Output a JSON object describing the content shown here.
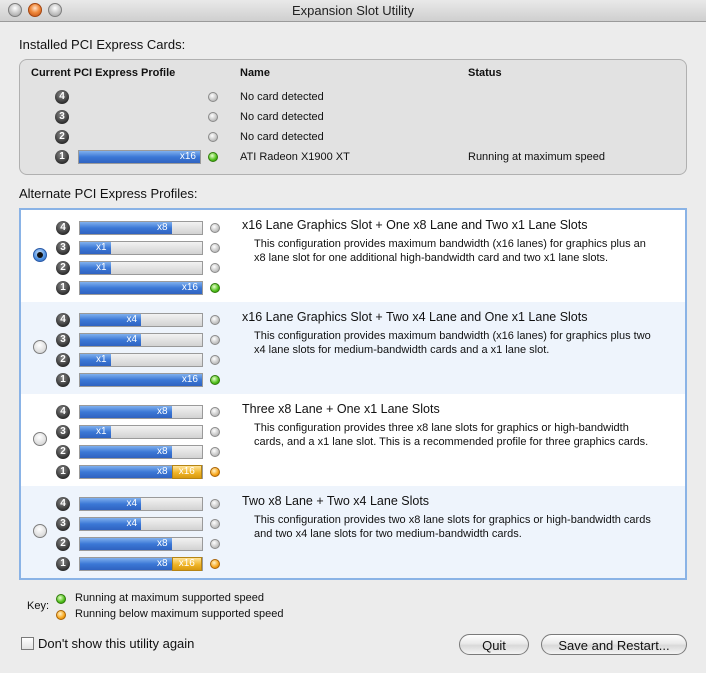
{
  "window": {
    "title": "Expansion Slot Utility"
  },
  "installed": {
    "section_label": "Installed PCI Express Cards:",
    "headers": {
      "profile": "Current PCI Express Profile",
      "name": "Name",
      "status": "Status"
    },
    "rows": [
      {
        "slot": "4",
        "name": "No card detected",
        "status": "",
        "led": "off",
        "lane_label": "",
        "fill": 0
      },
      {
        "slot": "3",
        "name": "No card detected",
        "status": "",
        "led": "off",
        "lane_label": "",
        "fill": 0
      },
      {
        "slot": "2",
        "name": "No card detected",
        "status": "",
        "led": "off",
        "lane_label": "",
        "fill": 0
      },
      {
        "slot": "1",
        "name": "ATI Radeon X1900 XT",
        "status": "Running at maximum speed",
        "led": "green",
        "lane_label": "x16",
        "fill": 1.0
      }
    ]
  },
  "alternate": {
    "section_label": "Alternate PCI Express Profiles:",
    "profiles": [
      {
        "title": "x16 Lane Graphics Slot + One x8 Lane and Two x1 Lane Slots",
        "description": "This configuration provides maximum bandwidth (x16 lanes) for graphics plus an x8 lane slot for one additional high-bandwidth card and two x1 lane slots.",
        "selected": true,
        "slots": [
          {
            "slot": "4",
            "label": "x8",
            "fill": 0.75,
            "extra": "",
            "led": "off"
          },
          {
            "slot": "3",
            "label": "x1",
            "fill": 0.25,
            "extra": "",
            "led": "off"
          },
          {
            "slot": "2",
            "label": "x1",
            "fill": 0.25,
            "extra": "",
            "led": "off"
          },
          {
            "slot": "1",
            "label": "x16",
            "fill": 1.0,
            "extra": "",
            "led": "green"
          }
        ]
      },
      {
        "title": "x16 Lane Graphics Slot + Two x4 Lane and One x1 Lane Slots",
        "description": "This configuration provides maximum bandwidth (x16 lanes) for graphics plus two x4 lane slots for medium-bandwidth cards and a x1 lane slot.",
        "selected": false,
        "slots": [
          {
            "slot": "4",
            "label": "x4",
            "fill": 0.5,
            "extra": "",
            "led": "off"
          },
          {
            "slot": "3",
            "label": "x4",
            "fill": 0.5,
            "extra": "",
            "led": "off"
          },
          {
            "slot": "2",
            "label": "x1",
            "fill": 0.25,
            "extra": "",
            "led": "off"
          },
          {
            "slot": "1",
            "label": "x16",
            "fill": 1.0,
            "extra": "",
            "led": "green"
          }
        ]
      },
      {
        "title": "Three x8 Lane + One x1 Lane Slots",
        "description": "This configuration provides three x8 lane slots for graphics or high-bandwidth cards, and a x1 lane slot.  This is a recommended profile for three graphics cards.",
        "selected": false,
        "slots": [
          {
            "slot": "4",
            "label": "x8",
            "fill": 0.75,
            "extra": "",
            "led": "off"
          },
          {
            "slot": "3",
            "label": "x1",
            "fill": 0.25,
            "extra": "",
            "led": "off"
          },
          {
            "slot": "2",
            "label": "x8",
            "fill": 0.75,
            "extra": "",
            "led": "off"
          },
          {
            "slot": "1",
            "label": "x8",
            "fill": 0.75,
            "extra": "x16",
            "led": "amber"
          }
        ]
      },
      {
        "title": "Two x8 Lane + Two x4 Lane Slots",
        "description": "This configuration provides two x8 lane slots for graphics or high-bandwidth cards and two x4 lane slots for two medium-bandwidth cards.",
        "selected": false,
        "slots": [
          {
            "slot": "4",
            "label": "x4",
            "fill": 0.5,
            "extra": "",
            "led": "off"
          },
          {
            "slot": "3",
            "label": "x4",
            "fill": 0.5,
            "extra": "",
            "led": "off"
          },
          {
            "slot": "2",
            "label": "x8",
            "fill": 0.75,
            "extra": "",
            "led": "off"
          },
          {
            "slot": "1",
            "label": "x8",
            "fill": 0.75,
            "extra": "x16",
            "led": "amber"
          }
        ]
      }
    ]
  },
  "key": {
    "label": "Key:",
    "items": [
      {
        "color": "green",
        "text": "Running at maximum supported speed"
      },
      {
        "color": "amber",
        "text": "Running below maximum supported speed"
      }
    ]
  },
  "footer": {
    "checkbox_label": "Don't show this utility again",
    "checkbox_checked": false,
    "quit_label": "Quit",
    "save_label": "Save and Restart..."
  }
}
